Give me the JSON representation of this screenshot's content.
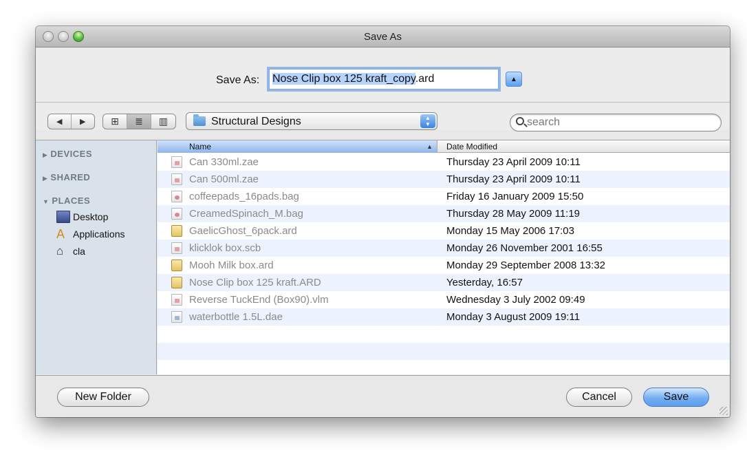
{
  "window": {
    "title": "Save As"
  },
  "save_as": {
    "label": "Save As:",
    "filename_selected": "Nose Clip box 125 kraft_copy",
    "filename_extension": ".ard",
    "expand_icon": "triangle-up-icon"
  },
  "toolbar": {
    "back_icon": "◀",
    "forward_icon": "▶",
    "view_icon_grid": "⊞",
    "view_icon_list": "≣",
    "view_icon_columns": "▥",
    "location": "Structural Designs",
    "search_placeholder": "search"
  },
  "sidebar": {
    "sections": [
      {
        "label": "DEVICES",
        "expanded": false
      },
      {
        "label": "SHARED",
        "expanded": false
      },
      {
        "label": "PLACES",
        "expanded": true
      }
    ],
    "places": [
      {
        "label": "Desktop",
        "icon": "desktop-icon"
      },
      {
        "label": "Applications",
        "icon": "applications-icon"
      },
      {
        "label": "cla",
        "icon": "home-icon"
      }
    ]
  },
  "file_list": {
    "columns": [
      "Name",
      "Date Modified"
    ],
    "sort_column": "Name",
    "rows": [
      {
        "name": "Can 330ml.zae",
        "date": "Thursday 23 April 2009 10:11",
        "icon": "document"
      },
      {
        "name": "Can 500ml.zae",
        "date": "Thursday 23 April 2009 10:11",
        "icon": "document"
      },
      {
        "name": "coffeepads_16pads.bag",
        "date": "Friday 16 January 2009 15:50",
        "icon": "bag"
      },
      {
        "name": "CreamedSpinach_M.bag",
        "date": "Thursday 28 May 2009 11:19",
        "icon": "bag"
      },
      {
        "name": "GaelicGhost_6pack.ard",
        "date": "Monday 15 May 2006 17:03",
        "icon": "box"
      },
      {
        "name": "klicklok box.scb",
        "date": "Monday 26 November 2001 16:55",
        "icon": "document"
      },
      {
        "name": "Mooh Milk box.ard",
        "date": "Monday 29 September 2008 13:32",
        "icon": "box"
      },
      {
        "name": "Nose Clip box 125 kraft.ARD",
        "date": "Yesterday, 16:57",
        "icon": "box"
      },
      {
        "name": "Reverse TuckEnd (Box90).vlm",
        "date": "Wednesday 3 July 2002 09:49",
        "icon": "document"
      },
      {
        "name": "waterbottle 1.5L.dae",
        "date": "Monday 3 August 2009 19:11",
        "icon": "bottle"
      }
    ]
  },
  "footer": {
    "new_folder_label": "New Folder",
    "cancel_label": "Cancel",
    "save_label": "Save"
  }
}
